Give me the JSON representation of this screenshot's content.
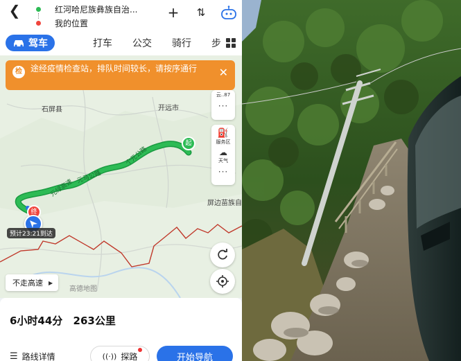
{
  "top_bar": {
    "back_icon": "back-arrow-icon",
    "destination": "红河哈尼族彝族自治...",
    "origin": "我的位置",
    "add_icon": "plus-icon",
    "swap_icon": "swap-icon",
    "assistant_icon": "robot-assistant-icon"
  },
  "modes": {
    "drive": "驾车",
    "taxi": "打车",
    "bus": "公交",
    "bike": "骑行",
    "walk": "步",
    "more_icon": "grid-icon"
  },
  "notice": {
    "badge": "检",
    "text": "途经疫情检查站，排队时间较长，请按序通行",
    "close_icon": "close-icon"
  },
  "side_tools": {
    "weather_small": "云..87",
    "service_area": "服务区",
    "weather": "天气",
    "more": "···"
  },
  "map": {
    "places": {
      "shiping": "石屏县",
      "kaiyuan": "开远市",
      "pingbian": "屏边苗族自"
    },
    "markers": {
      "start": "起",
      "end": "终"
    },
    "road_labels": {
      "road1": "个元公路",
      "road2": "元绿高速",
      "road3": "元马公路"
    },
    "eta": "预计23:21到达",
    "watermark": "高德地图",
    "colors": {
      "route": "#2dbb55",
      "border": "#c0392b",
      "accent": "#2a72e8"
    }
  },
  "avoid_highway": "不走高速",
  "refresh_icon": "refresh-icon",
  "locate_icon": "locate-icon",
  "summary": {
    "duration": "6小时44分",
    "distance": "263公里"
  },
  "actions": {
    "details": "路线详情",
    "explore": "探路",
    "start": "开始导航"
  }
}
